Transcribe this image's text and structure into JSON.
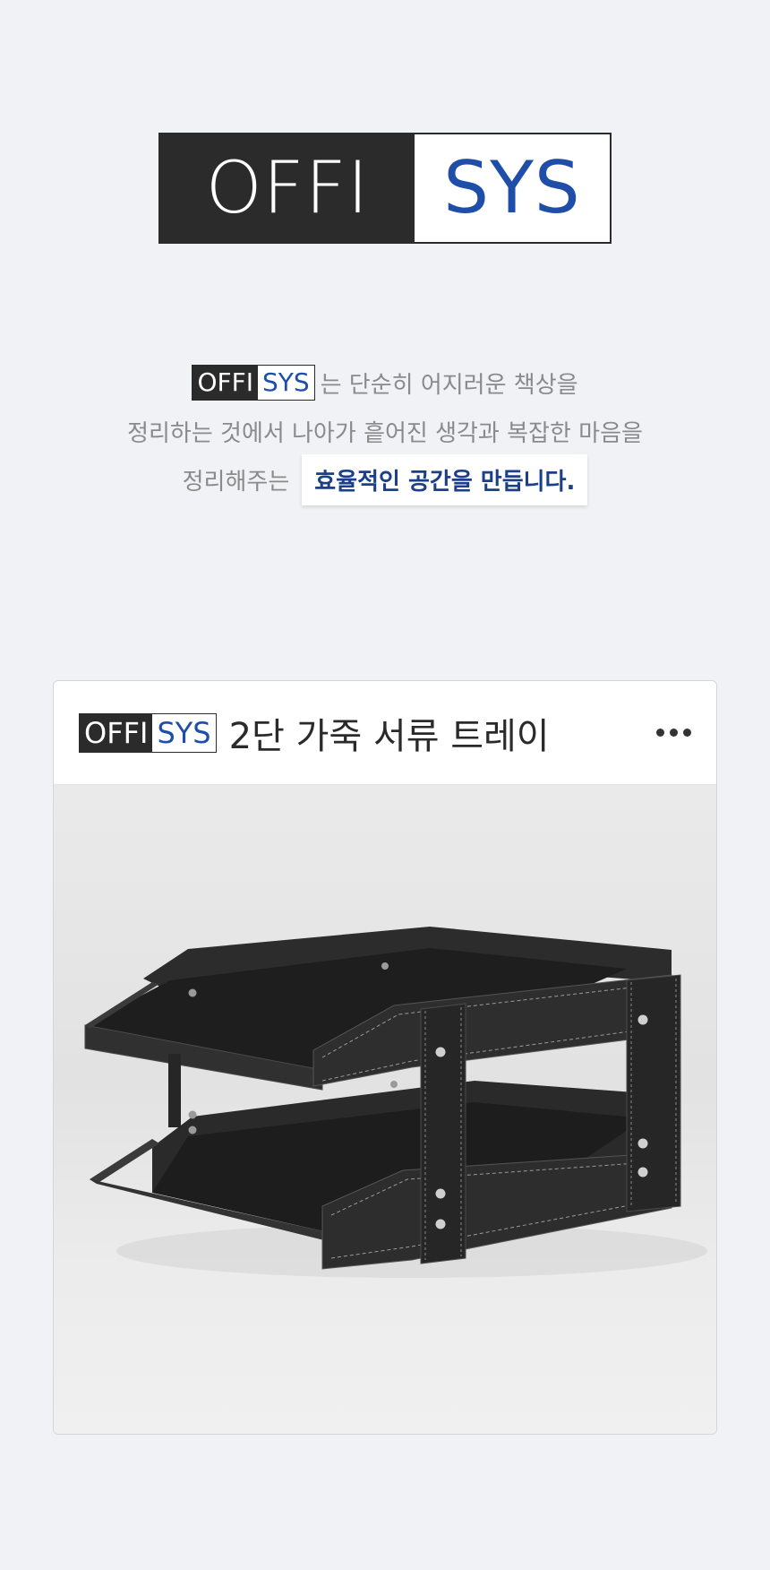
{
  "brand": {
    "logo_dark": "OFFI",
    "logo_light": "SYS",
    "accent_color": "#1e4ea8",
    "dark_color": "#2b2b2b"
  },
  "intro": {
    "line1_text": "는 단순히 어지러운 책상을",
    "line2_text": "정리하는 것에서 나아가 흩어진 생각과 복잡한 마음을",
    "line3_text": "정리해주는",
    "line3_highlight": "효율적인 공간을 만듭니다."
  },
  "card": {
    "title": "2단 가죽 서류 트레이",
    "more_icon": "more-horizontal-icon",
    "image_alt": "black leather two-tier document tray"
  }
}
